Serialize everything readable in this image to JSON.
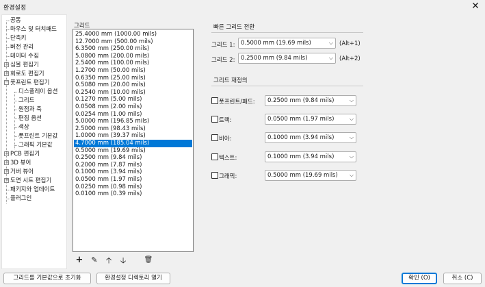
{
  "window": {
    "title": "환경설정",
    "close_label": "✕"
  },
  "tree": {
    "items": [
      {
        "label": "공통",
        "level": 1
      },
      {
        "label": "마우스 및 터치패드",
        "level": 1
      },
      {
        "label": "단축키",
        "level": 1
      },
      {
        "label": "버전 관리",
        "level": 1
      },
      {
        "label": "데이터 수집",
        "level": 1
      },
      {
        "label": "심볼 편집기",
        "level": 1,
        "expander": "+"
      },
      {
        "label": "회로도 편집기",
        "level": 1,
        "expander": "+"
      },
      {
        "label": "풋프린트 편집기",
        "level": 1,
        "expander": "−"
      },
      {
        "label": "디스플레이 옵션",
        "level": 2
      },
      {
        "label": "그리드",
        "level": 2
      },
      {
        "label": "원점과 축",
        "level": 2
      },
      {
        "label": "편집 옵션",
        "level": 2
      },
      {
        "label": "색상",
        "level": 2
      },
      {
        "label": "풋프린트 기본값",
        "level": 2
      },
      {
        "label": "그래픽 기본값",
        "level": 2
      },
      {
        "label": "PCB 편집기",
        "level": 1,
        "expander": "+"
      },
      {
        "label": "3D 뷰어",
        "level": 1,
        "expander": "+"
      },
      {
        "label": "거버 뷰어",
        "level": 1,
        "expander": "+"
      },
      {
        "label": "도면 시트 편집기",
        "level": 1,
        "expander": "+"
      },
      {
        "label": "패키지와 업데이트",
        "level": 1
      },
      {
        "label": "플러그인",
        "level": 1
      }
    ]
  },
  "grids": {
    "label": "그리드",
    "items": [
      "25.4000 mm (1000.00 mils)",
      "12.7000 mm (500.00 mils)",
      "6.3500 mm (250.00 mils)",
      "5.0800 mm (200.00 mils)",
      "2.5400 mm (100.00 mils)",
      "1.2700 mm (50.00 mils)",
      "0.6350 mm (25.00 mils)",
      "0.5080 mm (20.00 mils)",
      "0.2540 mm (10.00 mils)",
      "0.1270 mm (5.00 mils)",
      "0.0508 mm (2.00 mils)",
      "0.0254 mm (1.00 mils)",
      "5.0000 mm (196.85 mils)",
      "2.5000 mm (98.43 mils)",
      "1.0000 mm (39.37 mils)",
      "4.7000 mm (185.04 mils)",
      "0.5000 mm (19.69 mils)",
      "0.2500 mm (9.84 mils)",
      "0.2000 mm (7.87 mils)",
      "0.1000 mm (3.94 mils)",
      "0.0500 mm (1.97 mils)",
      "0.0250 mm (0.98 mils)",
      "0.0100 mm (0.39 mils)"
    ],
    "selected_index": 15
  },
  "toolbar": {
    "add_icon": "+",
    "edit_icon": "✎",
    "up_icon": "🡡",
    "down_icon": "🡣",
    "delete_icon": "🗑"
  },
  "fast_switch": {
    "title": "빠른 그리드 전환",
    "grid1_label": "그리드 1:",
    "grid1_value": "0.5000 mm (19.69 mils)",
    "grid1_hotkey": "(Alt+1)",
    "grid2_label": "그리드 2:",
    "grid2_value": "0.2500 mm (9.84 mils)",
    "grid2_hotkey": "(Alt+2)"
  },
  "overrides": {
    "title": "그리드 재정의",
    "rows": [
      {
        "label": "풋프린트/패드:",
        "value": "0.2500 mm (9.84 mils)"
      },
      {
        "label": "트랙:",
        "value": "0.0500 mm (1.97 mils)"
      },
      {
        "label": "비아:",
        "value": "0.1000 mm (3.94 mils)"
      },
      {
        "label": "텍스트:",
        "value": "0.1000 mm (3.94 mils)"
      },
      {
        "label": "그래픽:",
        "value": "0.5000 mm (19.69 mils)"
      }
    ]
  },
  "footer": {
    "reset_label": "그리드를 기본값으로 초기화",
    "open_dir_label": "환경설정 디렉토리 열기",
    "ok_label": "확인 (O)",
    "cancel_label": "취소 (C)"
  }
}
